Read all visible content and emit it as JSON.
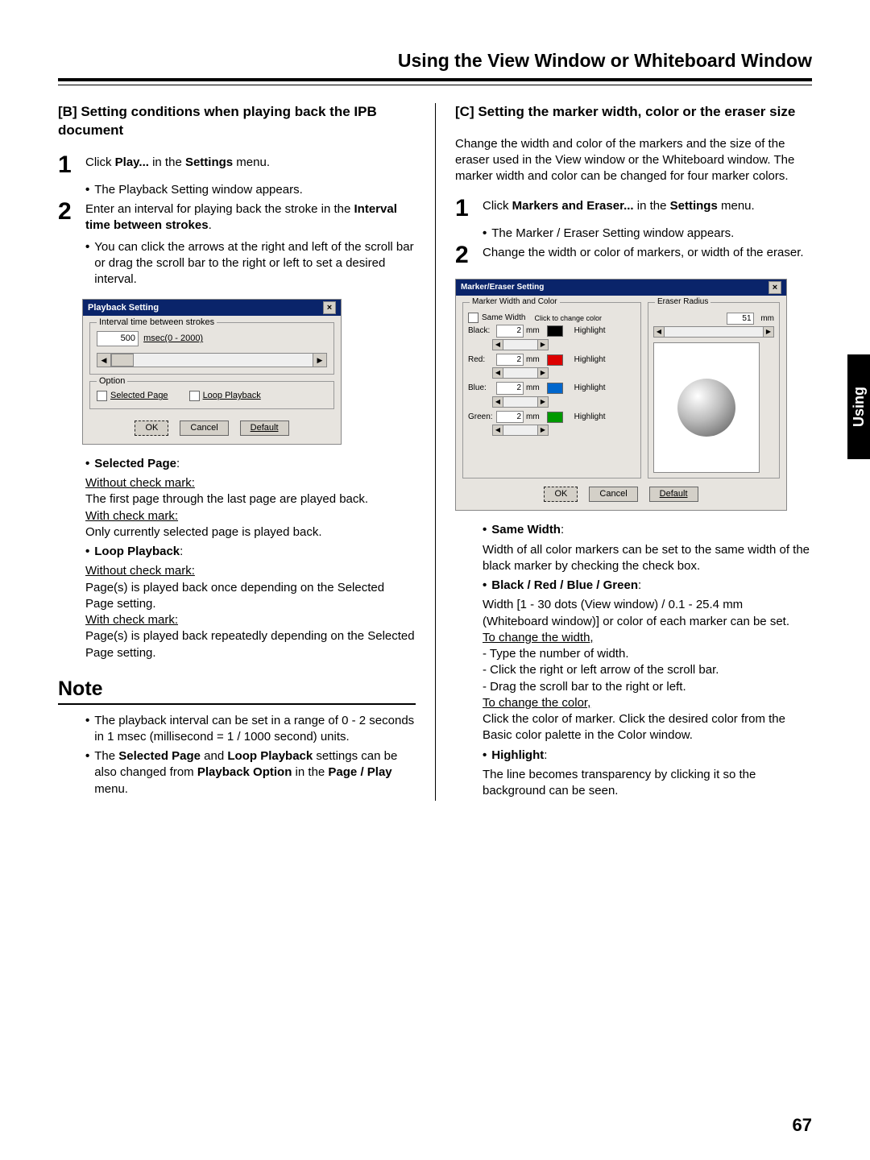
{
  "page": {
    "title": "Using the View Window or Whiteboard Window",
    "number": "67",
    "side_tab": "Using"
  },
  "left": {
    "heading": "[B] Setting conditions when playing back the IPB document",
    "step1_a": "Click ",
    "step1_b": "Play...",
    "step1_c": " in the ",
    "step1_d": "Settings",
    "step1_e": " menu.",
    "bullet1": "The Playback Setting window appears.",
    "step2_a": "Enter an interval for playing back the stroke in the ",
    "step2_b": "Interval time between strokes",
    "step2_c": ".",
    "bullet2": "You can click the arrows at the right and left of the scroll bar or drag the scroll bar to the right or left to set a desired interval.",
    "dlg": {
      "title": "Playback Setting",
      "group1": "Interval time between strokes",
      "value": "500",
      "unit": "msec(0 - 2000)",
      "group2": "Option",
      "opt1": "Selected Page",
      "opt2": "Loop Playback",
      "ok": "OK",
      "cancel": "Cancel",
      "default": "Default"
    },
    "sp_label": "Selected Page",
    "sp_wo": "Without check mark:",
    "sp_wo_txt": "The first page through the last page are played back.",
    "sp_w": "With check mark:",
    "sp_w_txt": "Only currently selected page is played back.",
    "lp_label": "Loop Playback",
    "lp_wo": "Without check mark:",
    "lp_wo_txt": "Page(s) is played back once depending on the Selected Page setting.",
    "lp_w": "With check mark:",
    "lp_w_txt": "Page(s) is played back repeatedly depending on the Selected Page setting.",
    "note": "Note",
    "note1": "The playback interval can be set in a range of 0 - 2 seconds in 1 msec (millisecond = 1 / 1000 second) units.",
    "note2_a": "The ",
    "note2_b": "Selected Page",
    "note2_c": " and ",
    "note2_d": "Loop Playback",
    "note2_e": " settings can be also changed from ",
    "note2_f": "Playback Option",
    "note2_g": " in the ",
    "note2_h": "Page / Play",
    "note2_i": " menu."
  },
  "right": {
    "heading": "[C] Setting the marker width, color or the eraser size",
    "intro": "Change the width and color of the markers and the size of the eraser used in the View window or the Whiteboard window. The marker width and color can be changed for four marker colors.",
    "s1_a": "Click ",
    "s1_b": "Markers and Eraser...",
    "s1_c": " in the ",
    "s1_d": "Settings",
    "s1_e": " menu.",
    "s1_bul": "The Marker / Eraser Setting window appears.",
    "s2": "Change the width or color of markers, or width of the eraser.",
    "dlg": {
      "title": "Marker/Eraser Setting",
      "grpL": "Marker Width and Color",
      "same": "Same Width",
      "click": "Click to change color",
      "black": "Black:",
      "red": "Red:",
      "blue": "Blue:",
      "green": "Green:",
      "mm": "mm",
      "hl": "Highlight",
      "val": "2",
      "grpR": "Eraser Radius",
      "rval": "51",
      "ok": "OK",
      "cancel": "Cancel",
      "default": "Default"
    },
    "sw_label": "Same Width",
    "sw_txt": "Width of all color markers can be set to the same width of the black marker by checking the check box.",
    "col_label": "Black / Red / Blue / Green",
    "col_txt": "Width [1 - 30 dots (View window) / 0.1 - 25.4 mm (Whiteboard window)] or color of each marker can be set.",
    "tcw": "To change the width,",
    "tcw1": "- Type the number of width.",
    "tcw2": "- Click the right or left arrow of the scroll bar.",
    "tcw3": "- Drag the scroll bar to the right or left.",
    "tcc": "To change the color,",
    "tcc_txt": "Click the color of marker. Click the desired color from the Basic color palette in the Color window.",
    "hl_label": "Highlight",
    "hl_txt": "The line becomes transparency by clicking it so the background can be seen."
  }
}
